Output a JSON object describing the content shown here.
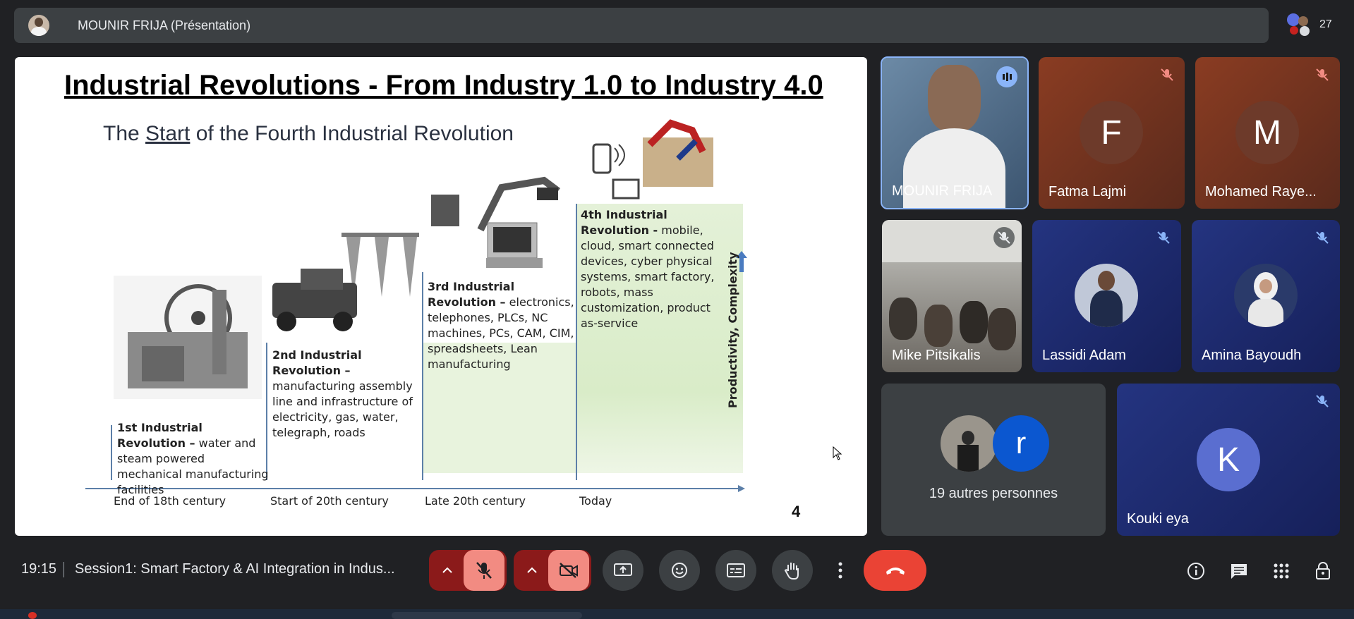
{
  "topbar": {
    "presenter_label": "MOUNIR FRIJA (Présentation)",
    "participant_count": "27"
  },
  "slide": {
    "title": "Industrial Revolutions - From Industry 1.0 to Industry 4.0",
    "subtitle_pre": "The ",
    "subtitle_underlined": "Start",
    "subtitle_post": " of the Fourth Industrial Revolution",
    "axis_label": "Productivity, Complexity",
    "page_number": "4",
    "revolutions": [
      {
        "heading": "1st Industrial Revolution –",
        "body": "water and steam powered mechanical manufacturing facilities",
        "era": "End of 18th century"
      },
      {
        "heading": "2nd Industrial Revolution –",
        "body": "manufacturing assembly line and infrastructure of electricity, gas, water, telegraph, roads",
        "era": "Start of 20th century"
      },
      {
        "heading": "3rd Industrial Revolution –",
        "body": "electronics, telephones, PLCs, NC machines, PCs, CAM, CIM, spreadsheets, Lean manufacturing",
        "era": "Late 20th century"
      },
      {
        "heading": "4th Industrial Revolution -",
        "body": "mobile, cloud, smart connected devices, cyber physical systems, smart factory, robots, mass customization, product as-service",
        "era": "Today"
      }
    ]
  },
  "tiles": {
    "mounir": "MOUNIR FRIJA",
    "fatma": {
      "name": "Fatma Lajmi",
      "initial": "F"
    },
    "mohamed": {
      "name": "Mohamed Raye...",
      "initial": "M"
    },
    "mike": "Mike Pitsikalis",
    "lassidi": "Lassidi Adam",
    "amina": "Amina Bayoudh",
    "others": {
      "label": "19 autres personnes",
      "initial": "r"
    },
    "kouki": {
      "name": "Kouki eya",
      "initial": "K"
    }
  },
  "bottombar": {
    "clock": "19:15",
    "meeting_title": "Session1: Smart Factory & AI Integration in Indus..."
  },
  "colors": {
    "background": "#202124",
    "tile_brown": "#7a3a24",
    "tile_blue": "#1f2a6b",
    "end_call": "#ea4335",
    "mute_red": "#f28b82"
  }
}
